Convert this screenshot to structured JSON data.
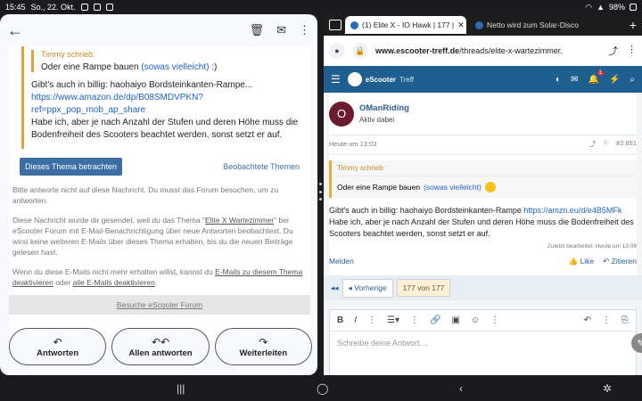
{
  "status": {
    "time": "15:45",
    "date": "So., 22. Okt.",
    "battery": "98%"
  },
  "mail": {
    "quote_author": "Timmy schrieb:",
    "quote_text": "Oder eine Rampe bauen",
    "quote_link": "(sowas vielleicht)",
    "quote_tail": ":)",
    "reply_line1": "Gibt's auch in billig: haohaiyo Bordsteinkanten-Rampe...",
    "reply_link1": "https://www.amazon.de/dp/B08SMDVPKN?",
    "reply_link2": "ref=ppx_pop_mob_ap_share",
    "reply_line2": "Habe ich, aber je nach Anzahl der Stufen und deren Höhe muss die Bodenfreiheit des Scooters beachtet werden, sonst setzt er auf.",
    "thema_button": "Dieses Thema betrachten",
    "watched_link": "Beobachtete Themen",
    "info1": "Bitte antworte nicht auf diese Nachricht. Du musst das Forum besuchen, um zu antworten.",
    "info2a": "Diese Nachricht wurde dir gesendet, weil du das Thema \"",
    "info2_link": "Elite X Wartezimmer",
    "info2b": "\" bei eScooter Forum mit E-Mail-Benachrichtigung über neue Antworten beobachtest. Du wirst keine weiteren E-Mails über dieses Thema erhalten, bis du die neuen Beiträge gelesen hast.",
    "info3a": "Wenn du diese E-Mails nicht mehr erhalten willst, kannst du ",
    "info3_link1": "E-Mails zu diesem Thema deaktivieren",
    "info3b": " oder ",
    "info3_link2": "alle E-Mails deaktivieren",
    "info3c": ".",
    "visit_forum": "Besuche eScooter Forum",
    "btn_reply": "Antworten",
    "btn_reply_all": "Allen antworten",
    "btn_forward": "Weiterleiten"
  },
  "browser": {
    "tab1": "(1) Elite X - IO Hawk | 177 |",
    "tab2": "Netto wird zum Solar-Disco",
    "url_domain": "www.escooter-treff.de",
    "url_path": "/threads/elite-x-wartezimmer.",
    "site_name": "eScooter",
    "site_sub": "Treff",
    "notif_count": "1",
    "username": "OManRiding",
    "role": "Aktiv dabei",
    "post_time": "Heute um 13:03",
    "post_number": "#2.651",
    "quote_author": "Timmy schrieb:",
    "quote_text": "Oder eine Rampe bauen",
    "quote_link": "(sowas vielleicht)",
    "post_text_a": "Gibt's auch in billig: haohaiyo Bordsteinkanten-Rampe ",
    "post_link": "https://amzn.eu/d/e4B5MFk",
    "post_text_b": "Habe ich, aber je nach Anzahl der Stufen und deren Höhe muss die Bodenfreiheit des Scooters beachtet werden, sonst setzt er auf.",
    "edited": "Zuletzt bearbeitet: Heute um 13:08",
    "report": "Melden",
    "like": "Like",
    "quote_action": "Zitieren",
    "prev": "Vorherige",
    "page": "177 von 177",
    "reply_placeholder": "Schreibe deine Antwort...."
  }
}
